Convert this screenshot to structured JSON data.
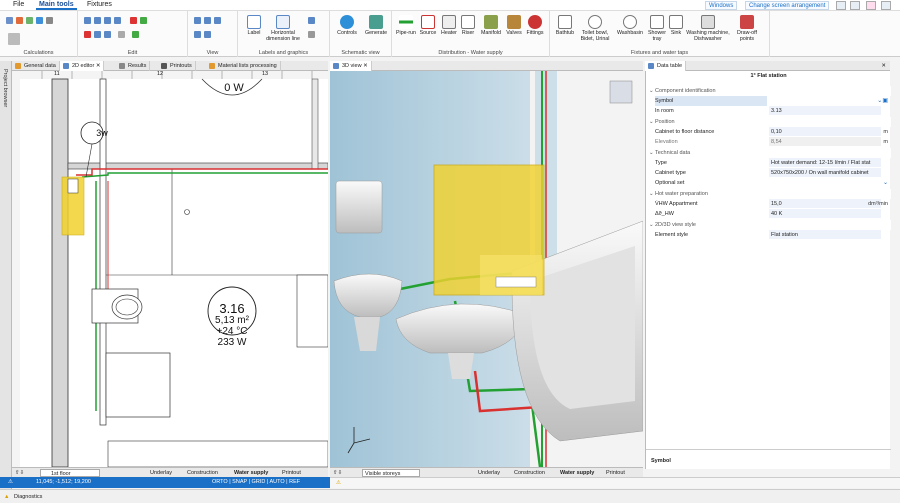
{
  "menu": {
    "file": "File",
    "main_tools": "Main tools",
    "fixtures": "Fixtures",
    "windows": "Windows",
    "arrange": "Change screen arrangement"
  },
  "ribbon": {
    "calculations": "Calculations",
    "edit": "Edit",
    "view": "View",
    "label": "Label",
    "horizontal_dimension_line": "Horizontal dimension line",
    "labels_and_graphics": "Labels and graphics",
    "controls": "Controls",
    "generate": "Generate",
    "schematic_view": "Schematic view",
    "pipe_run": "Pipe-run",
    "source": "Source",
    "heater": "Heater",
    "riser": "Riser",
    "manifold": "Manifold",
    "valves": "Valves",
    "fittings": "Fittings",
    "distribution": "Distribution - Water supply",
    "bathtub": "Bathtub",
    "toilet": "Toilet bowl, Bidet, Urinal",
    "washbasin": "Washbasin",
    "shower": "Shower tray",
    "sink": "Sink",
    "washing": "Washing machine, Dishwasher",
    "drawoff": "Draw-off points",
    "fixtures_taps": "Fixtures and water taps"
  },
  "tabs": {
    "general": "General data",
    "editor2d": "2D editor",
    "results": "Results",
    "printouts": "Printouts",
    "material": "Material lists processing",
    "view3d": "3D view",
    "datatable": "Data table"
  },
  "side": {
    "project_browser": "Project browser"
  },
  "editor": {
    "room_name": "3.16",
    "room_area": "5,13 m²",
    "room_temp": "+24 °C",
    "room_power": "233 W",
    "top_room_power": "0 W",
    "tag": "3w",
    "ruler": [
      "11",
      "12",
      "13"
    ]
  },
  "panel": {
    "title": "1° Flat station",
    "sections": {
      "ci": "Component identification",
      "pos": "Position",
      "tech": "Technical data",
      "hwp": "Hot water preparation",
      "view": "2D/3D view style"
    },
    "rows": {
      "symbol": "Symbol",
      "in_room": "In room",
      "in_room_v": "3.13",
      "cabinet": "Cabinet to floor distance",
      "cabinet_v": "0,10",
      "cabinet_u": "m",
      "elev": "Elevation",
      "elev_v": "8,54",
      "elev_u": "m",
      "type": "Type",
      "type_v": "Hot water demand: 12-15 l/min / Flat stat",
      "ctype": "Cabinet type",
      "ctype_v": "520x750x200 / On wall manifold cabinet",
      "opt": "Optional set",
      "vhw": "V̇HW Appartment",
      "vhw_v": "15,0",
      "vhw_u": "dm³/min",
      "dt": "Δϑ_HW",
      "dt_v": "40 K",
      "style": "Element style",
      "style_v": "Flat station"
    },
    "footer": "Symbol"
  },
  "bottom2d": {
    "floor": "1st floor",
    "underlay": "Underlay",
    "construction": "Construction",
    "water": "Water supply",
    "printout": "Printout"
  },
  "bottom3d": {
    "storeys": "Visible storeys",
    "underlay": "Underlay",
    "construction": "Construction",
    "water": "Water supply",
    "printout": "Printout"
  },
  "status": {
    "coords": "11,045; -1,512; 19,200",
    "modes": "ORTO | SNAP | GRID | AUTO | REF"
  },
  "diag": {
    "label": "Diagnostics"
  },
  "colors": {
    "accent": "#1a6fc7",
    "green_pipe": "#22a032",
    "red_pipe": "#d93030",
    "yellow": "#f2d22e"
  }
}
